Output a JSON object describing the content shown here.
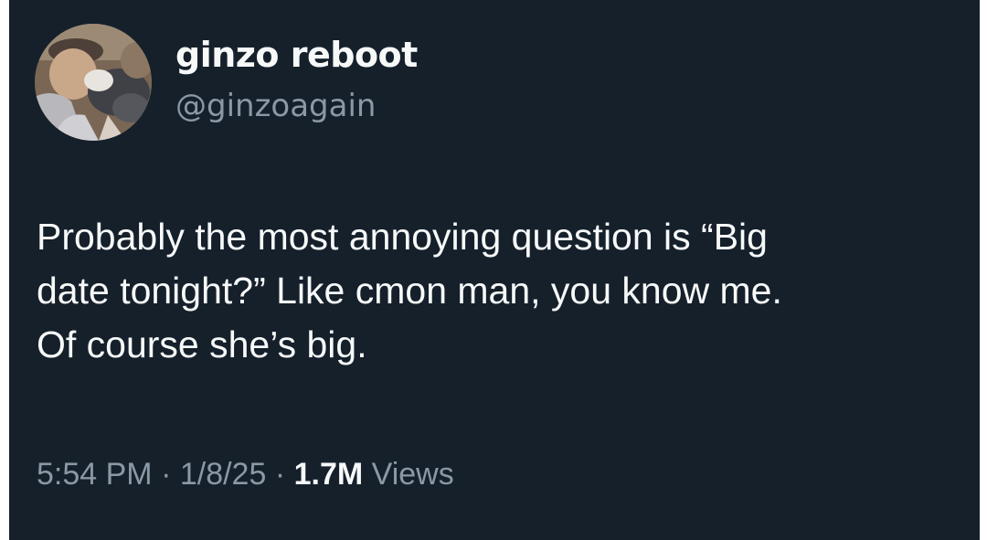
{
  "author": {
    "display_name": "ginzo reboot",
    "handle": "@ginzoagain"
  },
  "tweet": {
    "lines": [
      "Probably the most annoying question is “Big",
      "date tonight?” Like cmon man, you know me.",
      "Of course she’s big."
    ]
  },
  "meta": {
    "time": "5:54 PM",
    "separator_1": " · ",
    "date": "1/8/25",
    "separator_2": " · ",
    "views_count": "1.7M",
    "views_label": " Views"
  },
  "colors": {
    "background": "#15202b",
    "primary_text": "#f7f9f9",
    "secondary_text": "#8b98a5"
  }
}
